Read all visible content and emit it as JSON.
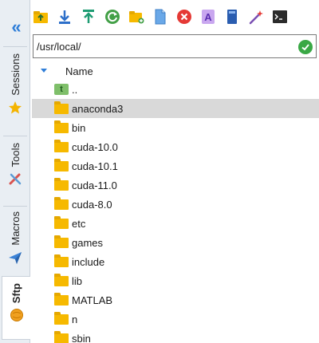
{
  "sidebar": {
    "collapse_icon": "double-chevron-left-icon",
    "tabs": [
      {
        "label": "Sessions",
        "icon": "star-icon",
        "active": false
      },
      {
        "label": "Tools",
        "icon": "wrench-screwdriver-icon",
        "active": false
      },
      {
        "label": "Macros",
        "icon": "paper-plane-icon",
        "active": false
      },
      {
        "label": "Sftp",
        "icon": "globe-icon",
        "active": true
      }
    ]
  },
  "toolbar": {
    "buttons": [
      "up-folder-icon",
      "download-icon",
      "upload-icon",
      "refresh-icon",
      "new-folder-icon",
      "new-file-icon",
      "delete-icon",
      "rename-icon",
      "open-terminal-icon",
      "magic-wand-icon",
      "terminal-icon"
    ]
  },
  "path": {
    "value": "/usr/local/",
    "status_icon": "check-icon"
  },
  "filelist": {
    "header": "Name",
    "rows": [
      {
        "name": "..",
        "type": "parent",
        "selected": false
      },
      {
        "name": "anaconda3",
        "type": "folder",
        "selected": true
      },
      {
        "name": "bin",
        "type": "folder",
        "selected": false
      },
      {
        "name": "cuda-10.0",
        "type": "folder",
        "selected": false
      },
      {
        "name": "cuda-10.1",
        "type": "folder",
        "selected": false
      },
      {
        "name": "cuda-11.0",
        "type": "folder",
        "selected": false
      },
      {
        "name": "cuda-8.0",
        "type": "folder",
        "selected": false
      },
      {
        "name": "etc",
        "type": "folder",
        "selected": false
      },
      {
        "name": "games",
        "type": "folder",
        "selected": false
      },
      {
        "name": "include",
        "type": "folder",
        "selected": false
      },
      {
        "name": "lib",
        "type": "folder",
        "selected": false
      },
      {
        "name": "MATLAB",
        "type": "folder",
        "selected": false
      },
      {
        "name": "n",
        "type": "folder",
        "selected": false
      },
      {
        "name": "sbin",
        "type": "folder",
        "selected": false
      }
    ]
  },
  "colors": {
    "accent": "#2f7ed8",
    "folder": "#f6b900",
    "selection": "#d9d9d9",
    "ok": "#3aa845"
  }
}
